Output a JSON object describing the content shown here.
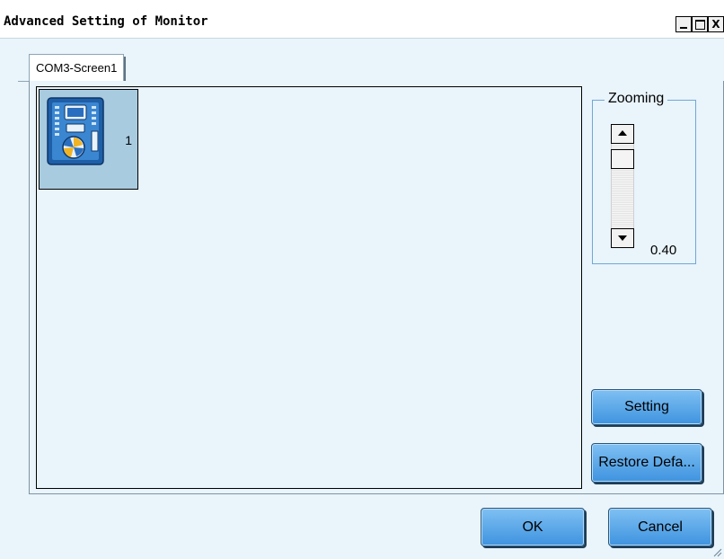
{
  "window": {
    "title": "Advanced Setting of Monitor",
    "controls": {
      "minimize": "_",
      "maximize": "□",
      "close": "X"
    }
  },
  "tabs": [
    {
      "label": "COM3-Screen1",
      "selected": true
    }
  ],
  "canvas": {
    "tiles": [
      {
        "number": "1",
        "icon": "receiving-card-icon"
      }
    ]
  },
  "zoom": {
    "label": "Zooming",
    "value": "0.40"
  },
  "buttons": {
    "setting": "Setting",
    "restore_defaults": "Restore Defa...",
    "ok": "OK",
    "cancel": "Cancel"
  },
  "colors": {
    "background": "#e9f4fb",
    "button_top": "#7fc0f3",
    "button_bottom": "#3e93df",
    "tile": "#a8cbe0"
  }
}
